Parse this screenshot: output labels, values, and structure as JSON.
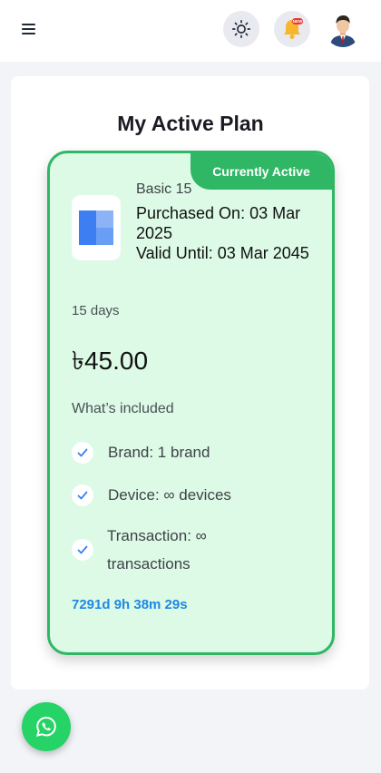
{
  "header": {
    "menu_icon": "hamburger-menu-icon",
    "theme_icon": "sun-icon",
    "notification_icon": "bell-icon",
    "notification_badge": "NEW",
    "avatar_icon": "user-avatar"
  },
  "page": {
    "title": "My Active Plan"
  },
  "plan": {
    "badge": "Currently Active",
    "name": "Basic 15",
    "purchased": "Purchased On: 03 Mar 2025",
    "valid_until": "Valid Until: 03 Mar 2045",
    "duration": "15 days",
    "price": "৳45.00",
    "included_title": "What’s included",
    "features": [
      {
        "label": "Brand: 1 brand"
      },
      {
        "label": "Device: ∞ devices"
      },
      {
        "label": "Transaction: ∞ transactions"
      }
    ],
    "countdown": "7291d 9h 38m 29s"
  },
  "colors": {
    "accent_green": "#2fb765",
    "card_bg": "#dcfae5",
    "countdown_blue": "#1e88e5",
    "whatsapp_green": "#25d366"
  },
  "fab": {
    "icon": "whatsapp-icon"
  }
}
